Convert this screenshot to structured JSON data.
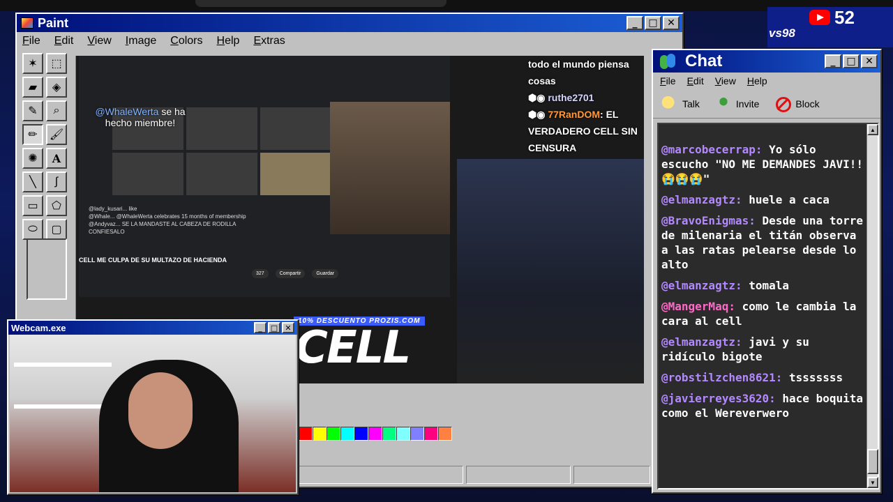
{
  "youtube_badge": {
    "count": "52",
    "sub": "vs98"
  },
  "paint": {
    "title": "Paint",
    "menu": [
      "File",
      "Edit",
      "View",
      "Image",
      "Colors",
      "Help",
      "Extras"
    ],
    "palette": [
      "#ff0000",
      "#ffff00",
      "#00ff00",
      "#00ffff",
      "#0000ff",
      "#ff00ff",
      "#00ff80",
      "#80ffff",
      "#8080ff",
      "#ff0080",
      "#ff8040"
    ]
  },
  "stream": {
    "member_user": "@WhaleWerta",
    "member_text": "se ha hecho miembre!",
    "chat_lines": [
      "@lady_kusari...  like",
      "@Whale...  @WhaleWerta celebrates 15 months of membership",
      "@Andyvaz...  SE LA MANDASTE AL CABEZA DE RODILLA CONFIESALO"
    ],
    "headline": "CELL ME CULPA DE SU MULTAZO DE HACIENDA",
    "actions": [
      "327",
      "Compartir",
      "Guardar"
    ],
    "promo": "10% DESCUENTO PROZIS.COM",
    "big_title": "CELL",
    "overlay": {
      "line1": "todo el mundo piensa cosas",
      "user1": "ruthe2701",
      "user2": "77RanDOM",
      "line2": ": EL VERDADERO CELL SIN CENSURA"
    }
  },
  "webcam": {
    "title": "Webcam.exe"
  },
  "chat": {
    "title": "Chat",
    "menu": [
      "File",
      "Edit",
      "View",
      "Help"
    ],
    "tools": [
      "Talk",
      "Invite",
      "Block"
    ],
    "messages": [
      {
        "user": "@marcobecerrap:",
        "text": "Yo sólo escucho \"NO ME DEMANDES JAVI!! 😭😭😭\"",
        "color": "purple"
      },
      {
        "user": "@elmanzagtz:",
        "text": "huele a caca",
        "color": "purple"
      },
      {
        "user": "@BravoEnigmas:",
        "text": "Desde una torre de milenaria el titán observa a las ratas pelearse desde lo alto",
        "color": "purple"
      },
      {
        "user": "@elmanzagtz:",
        "text": "tomala",
        "color": "purple"
      },
      {
        "user": "@MangerMaq:",
        "text": "como le cambia la cara al cell",
        "color": "pink"
      },
      {
        "user": "@elmanzagtz:",
        "text": "javi y su ridículo bigote",
        "color": "purple"
      },
      {
        "user": "@robstilzchen8621:",
        "text": "tsssssss",
        "color": "purple"
      },
      {
        "user": "@javierreyes3620:",
        "text": "hace boquita como el Wereverwero",
        "color": "purple"
      }
    ]
  }
}
